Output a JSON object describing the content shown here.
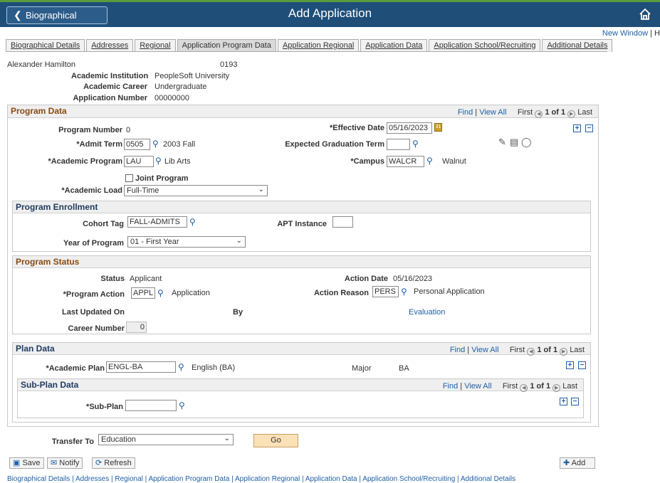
{
  "header": {
    "back_label": "Biographical Details",
    "title": "Add Application",
    "new_window": "New Window",
    "sep": "| H"
  },
  "tabs": [
    {
      "label": "Biographical Details"
    },
    {
      "label": "Addresses"
    },
    {
      "label": "Regional"
    },
    {
      "label": "Application Program Data",
      "active": true
    },
    {
      "label": "Application Regional"
    },
    {
      "label": "Application Data"
    },
    {
      "label": "Application School/Recruiting"
    },
    {
      "label": "Additional Details"
    }
  ],
  "person": {
    "name": "Alexander Hamilton",
    "id": "0193",
    "inst_label": "Academic Institution",
    "inst_value": "PeopleSoft University",
    "career_label": "Academic Career",
    "career_value": "Undergraduate",
    "appnum_label": "Application Number",
    "appnum_value": "00000000"
  },
  "program": {
    "title": "Program Data",
    "nav_find": "Find",
    "nav_viewall": "View All",
    "nav_first": "First",
    "nav_count": "1 of 1",
    "nav_last": "Last",
    "prog_num_label": "Program Number",
    "prog_num_value": "0",
    "eff_date_label": "*Effective Date",
    "eff_date_value": "05/16/2023",
    "admit_label": "*Admit Term",
    "admit_value": "0505",
    "admit_desc": "2003 Fall",
    "grad_label": "Expected Graduation Term",
    "grad_value": "",
    "acad_prog_label": "*Academic Program",
    "acad_prog_value": "LAU",
    "acad_prog_desc": "Lib Arts",
    "campus_label": "*Campus",
    "campus_value": "WALCR",
    "campus_desc": "Walnut",
    "joint_label": "Joint Program",
    "load_label": "*Academic Load",
    "load_value": "Full-Time"
  },
  "enrollment": {
    "title": "Program Enrollment",
    "cohort_label": "Cohort Tag",
    "cohort_value": "FALL-ADMITS",
    "apt_label": "APT Instance",
    "apt_value": "",
    "year_label": "Year of Program",
    "year_value": "01 - First Year"
  },
  "status": {
    "title": "Program Status",
    "status_label": "Status",
    "status_value": "Applicant",
    "action_date_label": "Action Date",
    "action_date_value": "05/16/2023",
    "prog_action_label": "*Program Action",
    "prog_action_value": "APPL",
    "prog_action_desc": "Application",
    "action_reason_label": "Action Reason",
    "action_reason_value": "PERS",
    "action_reason_desc": "Personal Application",
    "last_updated_label": "Last Updated On",
    "by_label": "By",
    "evaluation_link": "Evaluation",
    "career_num_label": "Career Number",
    "career_num_value": "0"
  },
  "plan": {
    "title": "Plan Data",
    "acad_plan_label": "*Academic Plan",
    "acad_plan_value": "ENGL-BA",
    "acad_plan_desc": "English (BA)",
    "major_label": "Major",
    "major_value": "BA"
  },
  "subplan": {
    "title": "Sub-Plan Data",
    "label": "*Sub-Plan",
    "value": ""
  },
  "bottom": {
    "transfer_label": "Transfer To",
    "transfer_value": "Education",
    "go_label": "Go",
    "save_label": "Save",
    "notify_label": "Notify",
    "refresh_label": "Refresh",
    "add_label": "Add",
    "footer_links": "Biographical Details | Addresses | Regional | Application Program Data | Application Regional | Application Data | Application School/Recruiting | Additional Details"
  }
}
